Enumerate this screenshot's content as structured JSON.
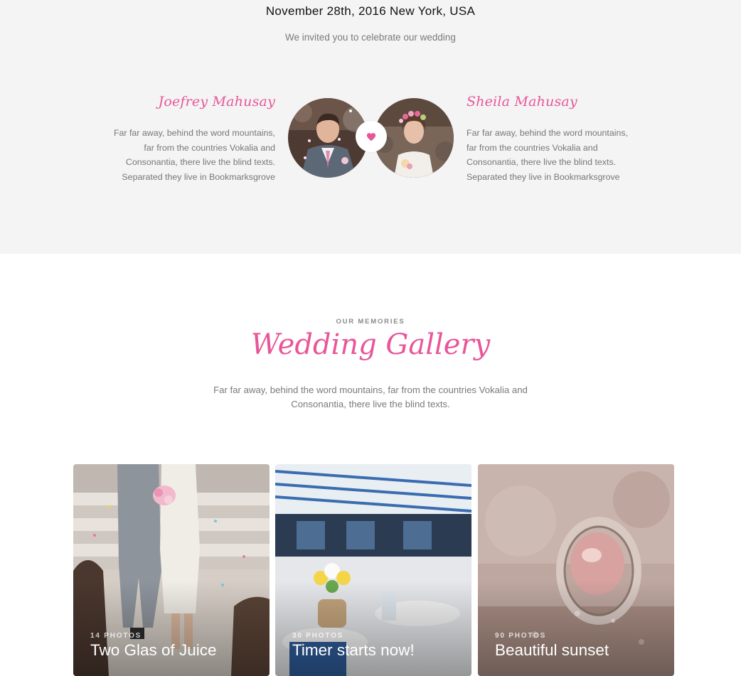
{
  "event": {
    "date_location": "November 28th, 2016 New York, USA",
    "invite": "We invited you to celebrate our wedding"
  },
  "couple": {
    "groom": {
      "name": "Joefrey Mahusay",
      "bio_lines": [
        "Far far away, behind the word mountains,",
        "far from the countries Vokalia and",
        "Consonantia, there live the blind texts.",
        "Separated they live in Bookmarksgrove"
      ]
    },
    "bride": {
      "name": "Sheila Mahusay",
      "bio_lines": [
        "Far far away, behind the word mountains,",
        "far from the countries Vokalia and",
        "Consonantia, there live the blind texts.",
        "Separated they live in Bookmarksgrove"
      ]
    },
    "heart_icon": "heart-icon"
  },
  "gallery": {
    "eyebrow": "OUR MEMORIES",
    "title": "Wedding Gallery",
    "description_lines": [
      "Far far away, behind the word mountains, far from the countries Vokalia and",
      "Consonantia, there live the blind texts."
    ],
    "cards": [
      {
        "count": "14 PHOTOS",
        "title": "Two Glas of Juice"
      },
      {
        "count": "30 PHOTOS",
        "title": "Timer starts now!"
      },
      {
        "count": "90 PHOTOS",
        "title": "Beautiful sunset"
      }
    ]
  },
  "colors": {
    "accent": "#e8569a",
    "section_bg": "#f4f4f4",
    "body_text": "#777777"
  }
}
